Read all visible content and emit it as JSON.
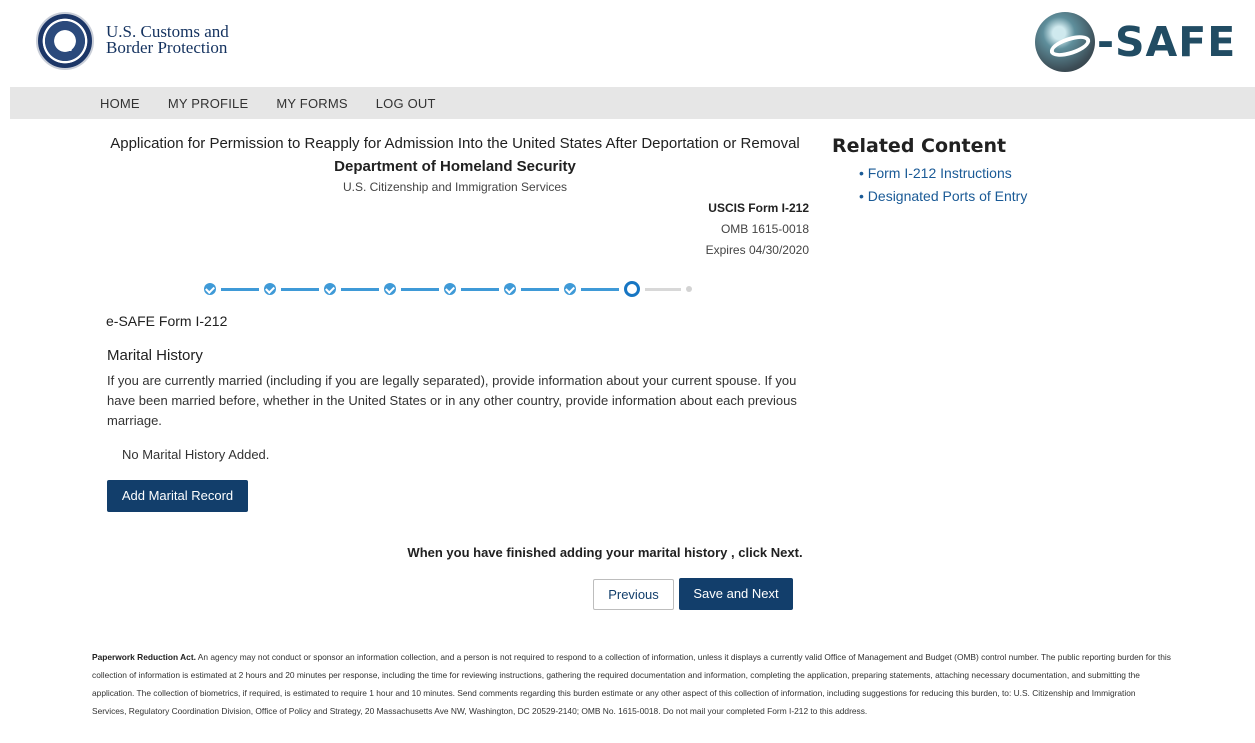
{
  "header": {
    "agency_line1": "U.S. Customs and",
    "agency_line2": "Border Protection",
    "brand": "-SAFE"
  },
  "nav": {
    "items": [
      "HOME",
      "MY PROFILE",
      "MY FORMS",
      "LOG OUT"
    ]
  },
  "page": {
    "title": "Application for Permission to Reapply for Admission Into the United States After Deportation or Removal",
    "department": "Department of Homeland Security",
    "subagency": "U.S. Citizenship and Immigration Services",
    "form_number": "USCIS Form I-212",
    "omb": "OMB 1615-0018",
    "expires": "Expires 04/30/2020"
  },
  "progress": {
    "completed_steps": 7,
    "current_step": 8,
    "total_steps": 9
  },
  "form": {
    "heading": "e-SAFE Form I-212",
    "section_title": "Marital History",
    "section_description": "If you are currently married (including if you are legally separated), provide information about your current spouse. If you have been married before, whether in the United States or in any other country, provide information about each previous marriage.",
    "empty_message": "No Marital History Added.",
    "add_button": "Add Marital Record",
    "finish_instruction": "When you have finished adding your marital history , click Next.",
    "previous_button": "Previous",
    "next_button": "Save and Next"
  },
  "related": {
    "title": "Related Content",
    "links": [
      "Form I-212 Instructions",
      "Designated Ports of Entry"
    ]
  },
  "footer": {
    "paperwork_label": "Paperwork Reduction Act.",
    "paperwork_text": " An agency may not conduct or sponsor an information collection, and a person is not required to respond to a collection of information, unless it displays a currently valid Office of Management and Budget (OMB) control number.  The public reporting burden for this collection of information is estimated at 2 hours and 20 minutes per response, including the time for reviewing instructions, gathering the required documentation and information, completing the application, preparing statements, attaching necessary documentation, and submitting the application.  The collection of biometrics, if required, is estimated to require 1 hour and 10 minutes.  Send comments regarding this burden estimate or any other aspect of this collection of information, including suggestions for reducing this burden, to:  U.S. Citizenship and Immigration Services, Regulatory Coordination Division, Office of Policy and Strategy, 20 Massachusetts Ave NW, Washington, DC 20529-2140; OMB No. 1615-0018.  Do not mail your completed Form I-212 to this address."
  },
  "colors": {
    "primary_button": "#123e6b",
    "progress_complete": "#3f9ad7",
    "progress_current": "#1776c3",
    "link": "#1a5a96",
    "nav_bg": "#e6e6e6"
  }
}
